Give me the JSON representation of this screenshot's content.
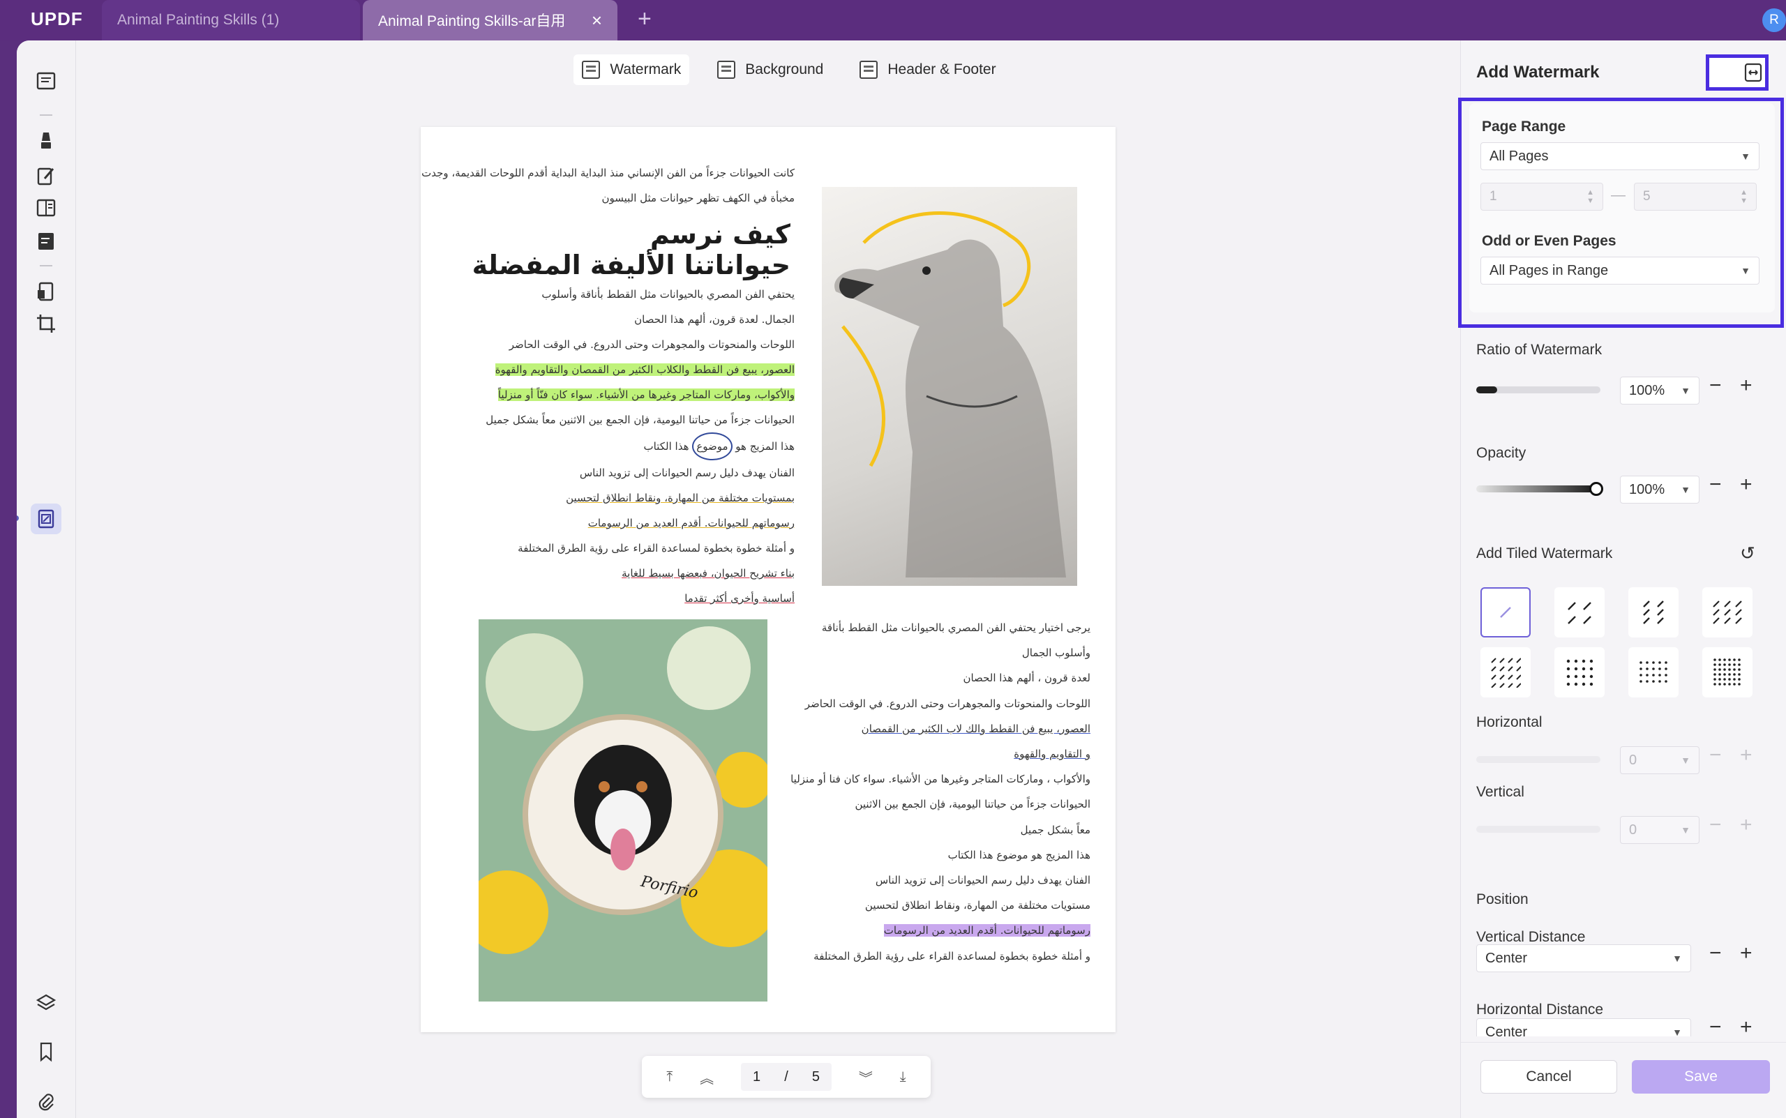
{
  "app": {
    "logo": "UPDF",
    "avatar_initial": "R"
  },
  "tabs": [
    {
      "label": "Animal Painting Skills (1)",
      "active": false
    },
    {
      "label": "Animal Painting Skills-ar自用",
      "active": true
    }
  ],
  "tabs_close_icon": "×",
  "new_tab": "+",
  "toolbar": {
    "watermark": "Watermark",
    "background": "Background",
    "header_footer": "Header & Footer"
  },
  "document": {
    "intro_lines": [
      "كانت الحيوانات جزءاً من الفن الإنساني منذ البداية البداية أقدم اللوحات القديمة، وجدت",
      "مخبأة في الكهف تظهر حيوانات مثل البيسون"
    ],
    "heading_lines": [
      "كيف نرسم",
      "حيواناتنا الأليفة المفضلة"
    ],
    "body_lines": [
      "يحتفي الفن المصري بالحيوانات مثل القطط بأناقة وأسلوب",
      "الجمال. لعدة قرون، ألهم هذا الحصان",
      "اللوحات والمنحوتات والمجوهرات وحتى الدروع. في الوقت الحاضر",
      "العصور، يبيع فن القطط والكلاب الكثير من القمصان والتقاويم والقهوة",
      "والأكواب، وماركات المتاجر وغيرها من الأشياء. سواء كان فنّاً أو منزلياً",
      "الحيوانات جزءاً من حياتنا اليومية، فإن الجمع بين الاثنين معاً بشكل جميل",
      "هذا المزيج هو",
      "موضوع",
      "هذا الكتاب",
      "الفنان يهدف دليل رسم الحيوانات إلى تزويد الناس",
      "بمستويات مختلفة من المهارة، ونقاط انطلاق لتحسين",
      "رسوماتهم للحيوانات. أقدم العديد من الرسومات",
      "و أمثلة خطوة بخطوة لمساعدة القراء على رؤية الطرق المختلفة",
      "بناء تشريح الحيوان، فبعضها بسيط للغاية",
      "أساسية وأخرى أكثر تقدما"
    ],
    "body2_lines": [
      "يرجى اختيار يحتفي الفن المصري بالحيوانات مثل القطط بأناقة",
      "وأسلوب الجمال",
      "لعدة قرون ، ألهم هذا الحصان",
      "اللوحات والمنحوتات والمجوهرات وحتى الدروع. في الوقت الحاضر",
      "العصور، يبيع فن القطط والك  لاب الكثير من القمصان",
      "و التقاويم والقهوة",
      "والأكواب ، وماركات المتاجر وغيرها من الأشياء. سواء كان فنا أو منزليا",
      "الحيوانات جزءاً من حياتنا اليومية، فإن الجمع بين الاثنين",
      "معاً بشكل جميل",
      "هذا المزيج هو موضوع هذا الكتاب",
      "الفنان يهدف دليل رسم الحيوانات إلى تزويد الناس",
      "مستويات مختلفة من المهارة، ونقاط انطلاق لتحسين",
      "رسوماتهم للحيوانات. أقدم العديد من الرسومات",
      "و أمثلة خطوة بخطوة لمساعدة القراء على رؤية الطرق المختلفة"
    ],
    "embroidery_text": "Porfirio"
  },
  "pager": {
    "current": "1",
    "separator": "/",
    "total": "5"
  },
  "panel": {
    "title": "Add Watermark",
    "page_range_label": "Page Range",
    "page_range_value": "All Pages",
    "range_from": "1",
    "range_dash": "—",
    "range_to": "5",
    "odd_even_label": "Odd or Even Pages",
    "odd_even_value": "All Pages in Range",
    "ratio_label": "Ratio of Watermark",
    "ratio_value": "100%",
    "ratio_level": 0.12,
    "opacity_label": "Opacity",
    "opacity_value": "100%",
    "opacity_level": 1.0,
    "tiled_label": "Add Tiled Watermark",
    "horizontal_label": "Horizontal",
    "horizontal_value": "0",
    "vertical_label": "Vertical",
    "vertical_value": "0",
    "position_label": "Position",
    "vdist_label": "Vertical Distance",
    "vdist_value": "Center",
    "hdist_label": "Horizontal Distance",
    "hdist_value": "Center",
    "minus": "−",
    "plus": "+",
    "cancel": "Cancel",
    "save": "Save"
  },
  "colors": {
    "accent": "#5b2d7e",
    "highlight_box": "#4a2de0",
    "save_button": "#bba8f2"
  }
}
